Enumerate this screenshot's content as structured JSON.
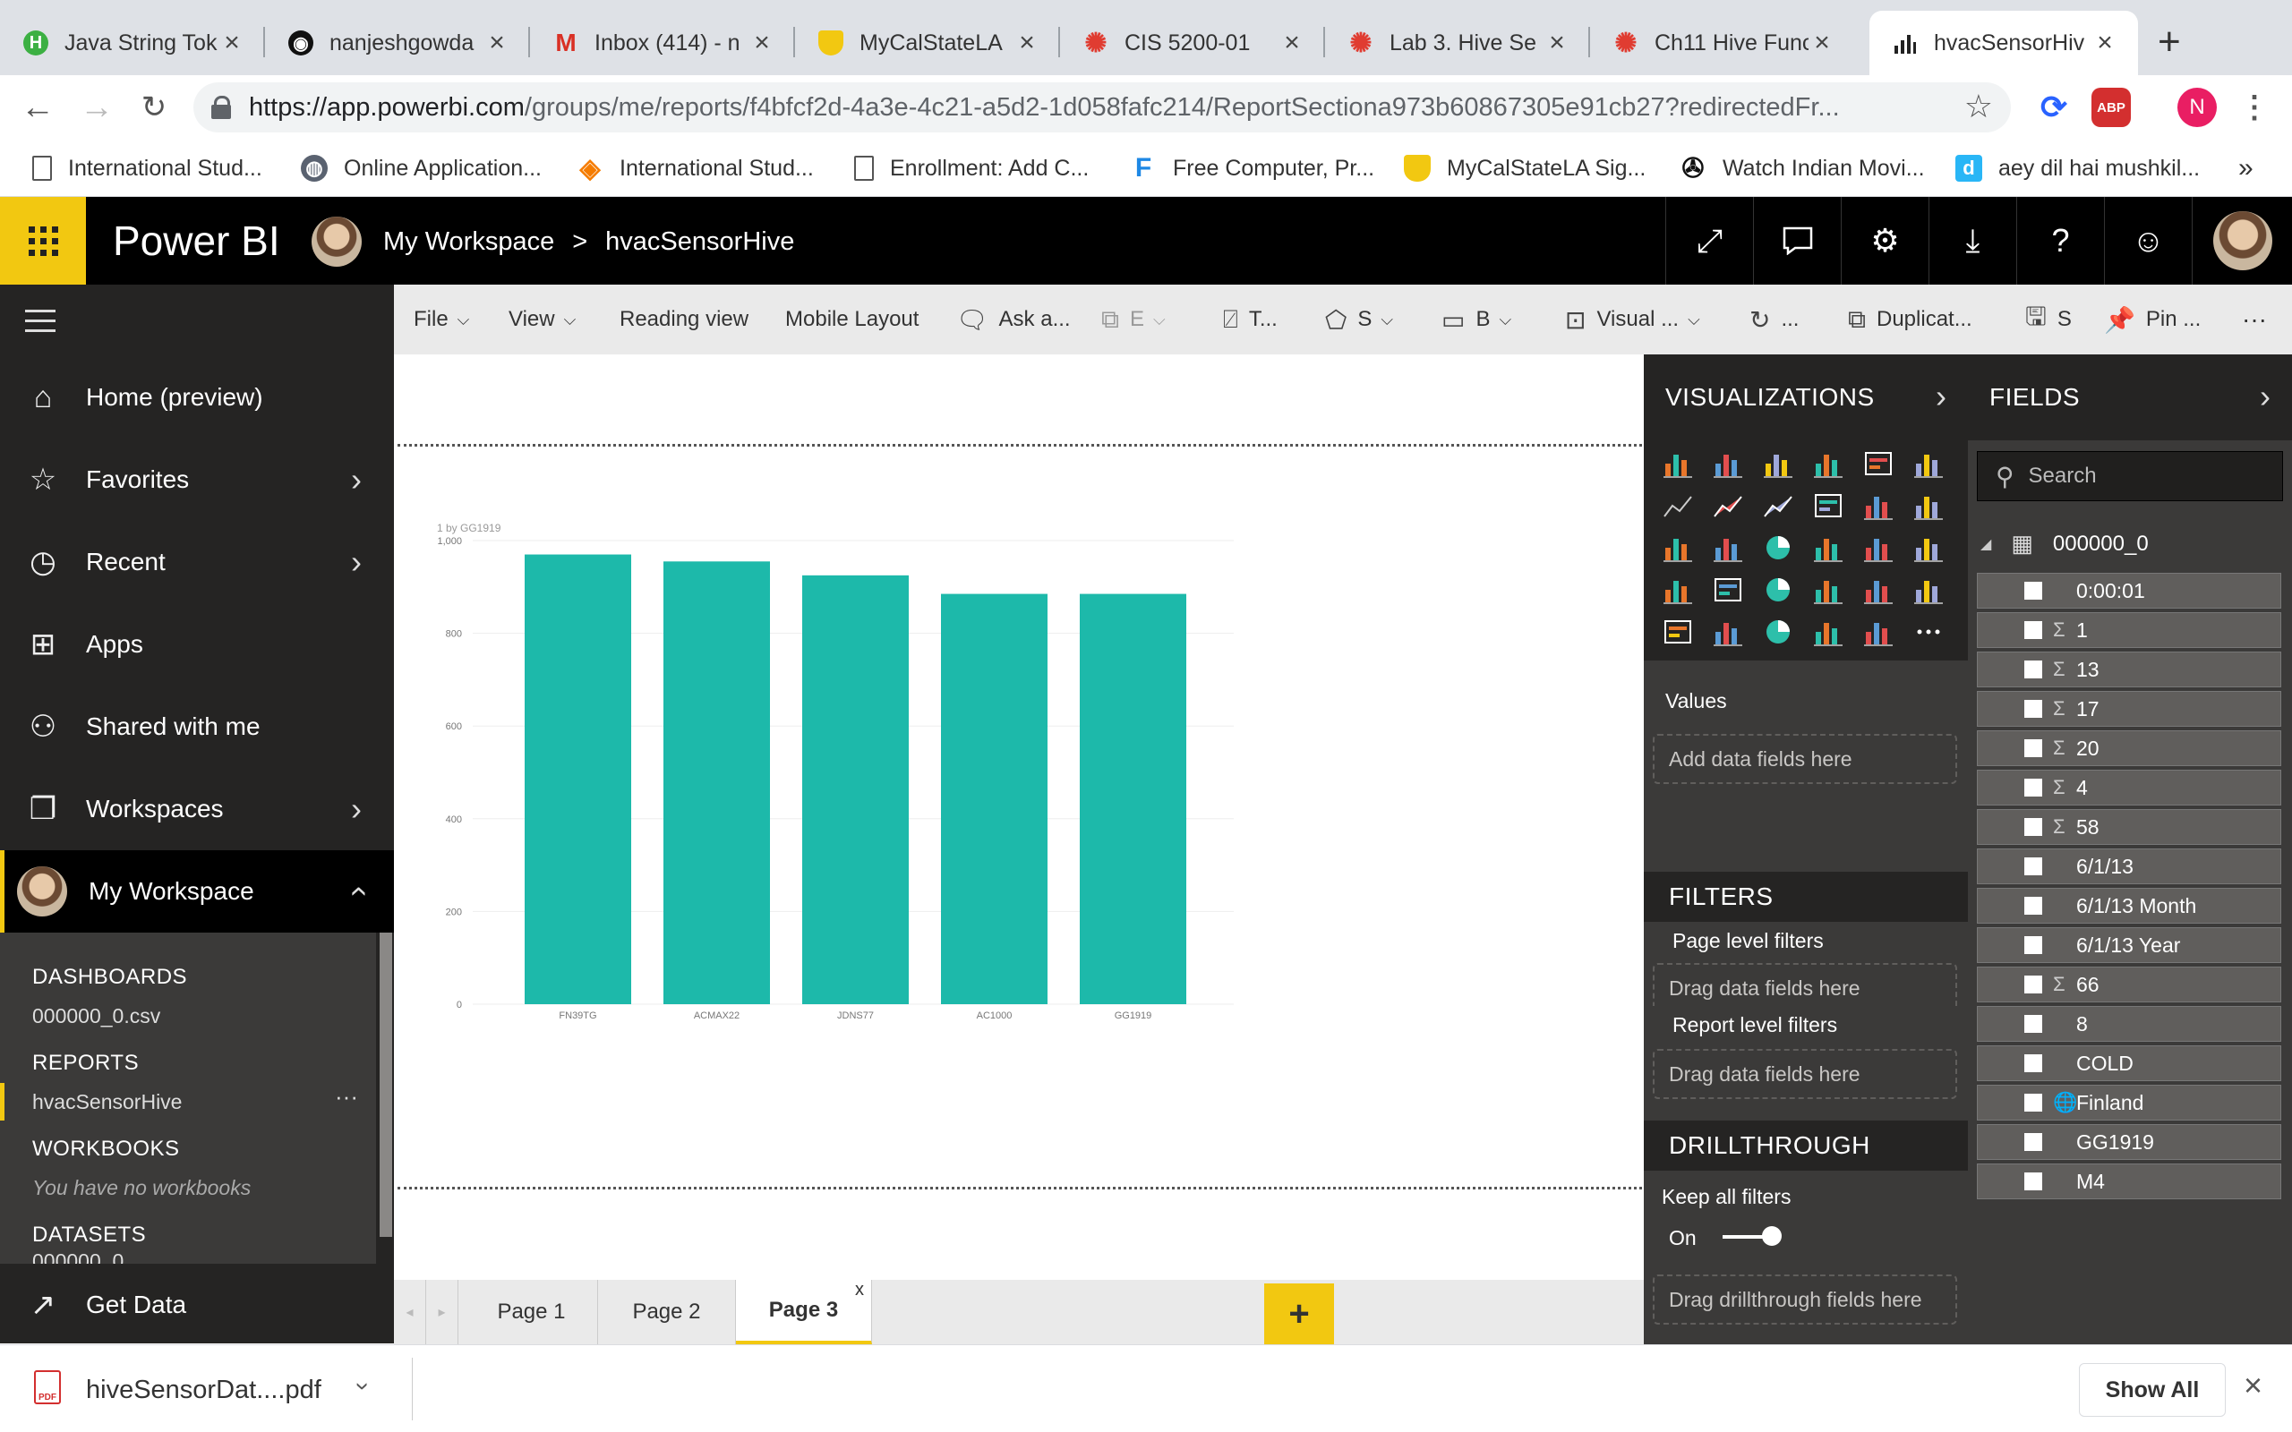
{
  "browser": {
    "tabs": [
      {
        "title": "Java String Tok",
        "icon": "h-logo-icon",
        "color": "#3cb043"
      },
      {
        "title": "nanjeshgowda",
        "icon": "github-icon",
        "color": "#111111"
      },
      {
        "title": "Inbox (414) - n",
        "icon": "gmail-icon",
        "color": "#d93025"
      },
      {
        "title": "MyCalStateLA",
        "icon": "shield-icon",
        "color": "#f2c811"
      },
      {
        "title": "CIS 5200-01",
        "icon": "canvas-icon",
        "color": "#e03c31"
      },
      {
        "title": "Lab 3. Hive Se",
        "icon": "canvas-icon",
        "color": "#e03c31"
      },
      {
        "title": "Ch11 Hive Func",
        "icon": "canvas-icon",
        "color": "#e03c31"
      },
      {
        "title": "hvacSensorHiv",
        "icon": "powerbi-icon",
        "color": "#222222",
        "active": true
      }
    ],
    "url": "https://app.powerbi.com/groups/me/reports/f4bfcf2d-4a3e-4c21-a5d2-1d058fafc214/ReportSectiona973b60867305e91cb27?redirectedFr...",
    "url_host": "https://app.powerbi.com",
    "url_path": "/groups/me/reports/f4bfcf2d-4a3e-4c21-a5d2-1d058fafc214/ReportSectiona973b60867305e91cb27?redirectedFr...",
    "extensions": {
      "abp": "ABP",
      "profile": "N"
    },
    "bookmarks": [
      {
        "label": "International Stud...",
        "icon": "page-icon"
      },
      {
        "label": "Online Application...",
        "icon": "globe-icon"
      },
      {
        "label": "International Stud...",
        "icon": "diamond-icon"
      },
      {
        "label": "Enrollment: Add C...",
        "icon": "page-icon"
      },
      {
        "label": "Free Computer, Pr...",
        "icon": "f-icon"
      },
      {
        "label": "MyCalStateLA Sig...",
        "icon": "shield-icon"
      },
      {
        "label": "Watch Indian Movi...",
        "icon": "reel-icon"
      },
      {
        "label": "aey dil hai mushkil...",
        "icon": "d-icon"
      }
    ],
    "more_bookmarks": "»"
  },
  "pbi_header": {
    "brand": "Power BI",
    "breadcrumb_workspace": "My Workspace",
    "breadcrumb_sep": ">",
    "breadcrumb_report": "hvacSensorHive"
  },
  "leftnav": {
    "items": [
      {
        "label": "Home (preview)"
      },
      {
        "label": "Favorites"
      },
      {
        "label": "Recent"
      },
      {
        "label": "Apps"
      },
      {
        "label": "Shared with me"
      },
      {
        "label": "Workspaces"
      },
      {
        "label": "My Workspace"
      }
    ],
    "sections": {
      "dashboards_h": "DASHBOARDS",
      "dashboards_v": "000000_0.csv",
      "reports_h": "REPORTS",
      "reports_v": "hvacSensorHive",
      "reports_more": "···",
      "workbooks_h": "WORKBOOKS",
      "workbooks_v": "You have no workbooks",
      "datasets_h": "DATASETS",
      "datasets_v": "000000_0"
    },
    "get_data": "Get Data"
  },
  "toolbar": {
    "file": "File",
    "view": "View",
    "reading_view": "Reading view",
    "mobile_layout": "Mobile Layout",
    "ask": "Ask a...",
    "explore": "E",
    "textbox": "T...",
    "shapes": "S",
    "buttons": "B",
    "visual": "Visual ...",
    "refresh": "...",
    "duplicate": "Duplicat...",
    "save": "S",
    "pin": "Pin ...",
    "more": "···"
  },
  "chart_data": {
    "type": "bar",
    "title": "1 by GG1919",
    "categories": [
      "FN39TG",
      "ACMAX22",
      "JDNS77",
      "AC1000",
      "GG1919"
    ],
    "values": [
      970,
      955,
      925,
      885,
      885
    ],
    "ylim": [
      0,
      1000
    ],
    "yticks": [
      0,
      200,
      400,
      600,
      800,
      1000
    ],
    "yticklabels": [
      "0",
      "200",
      "400",
      "600",
      "800",
      "1,000"
    ],
    "grid": true,
    "color": "#1db9aa"
  },
  "pages": {
    "tabs": [
      "Page 1",
      "Page 2",
      "Page 3"
    ],
    "active": "Page 3",
    "close": "x",
    "add": "+"
  },
  "viz": {
    "title": "VISUALIZATIONS",
    "values_label": "Values",
    "values_well": "Add data fields here",
    "filters_h": "FILTERS",
    "page_filters": "Page level filters",
    "page_well": "Drag data fields here",
    "report_filters": "Report level filters",
    "report_well": "Drag data fields here",
    "drill_h": "DRILLTHROUGH",
    "keep_filters": "Keep all filters",
    "toggle_state": "On",
    "drill_well": "Drag drillthrough fields here"
  },
  "fields": {
    "title": "FIELDS",
    "search_placeholder": "Search",
    "table": "000000_0",
    "items": [
      {
        "name": "0:00:01",
        "sigma": ""
      },
      {
        "name": "1",
        "sigma": "Σ"
      },
      {
        "name": "13",
        "sigma": "Σ"
      },
      {
        "name": "17",
        "sigma": "Σ"
      },
      {
        "name": "20",
        "sigma": "Σ"
      },
      {
        "name": "4",
        "sigma": "Σ"
      },
      {
        "name": "58",
        "sigma": "Σ"
      },
      {
        "name": "6/1/13",
        "sigma": ""
      },
      {
        "name": "6/1/13 Month",
        "sigma": ""
      },
      {
        "name": "6/1/13 Year",
        "sigma": ""
      },
      {
        "name": "66",
        "sigma": "Σ"
      },
      {
        "name": "8",
        "sigma": ""
      },
      {
        "name": "COLD",
        "sigma": ""
      },
      {
        "name": "Finland",
        "sigma": "🌐"
      },
      {
        "name": "GG1919",
        "sigma": ""
      },
      {
        "name": "M4",
        "sigma": ""
      }
    ]
  },
  "download": {
    "filename": "hiveSensorDat....pdf",
    "show_all": "Show All"
  }
}
